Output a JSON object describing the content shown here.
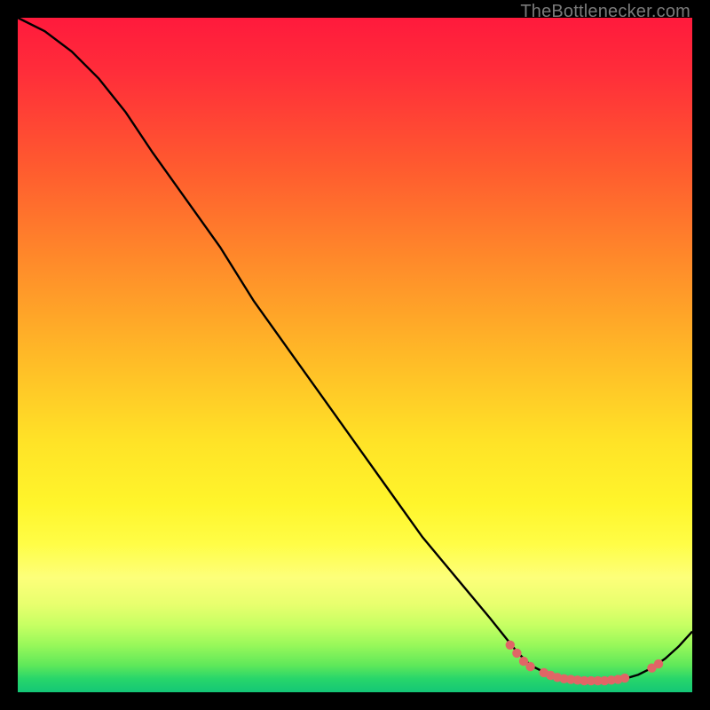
{
  "watermark": "TheBottlenecker.com",
  "chart_data": {
    "type": "line",
    "title": "",
    "xlabel": "",
    "ylabel": "",
    "xlim": [
      0,
      100
    ],
    "ylim": [
      0,
      100
    ],
    "series": [
      {
        "name": "curve",
        "x": [
          0,
          4,
          8,
          12,
          16,
          20,
          25,
          30,
          35,
          40,
          45,
          50,
          55,
          60,
          65,
          70,
          74,
          76,
          78,
          80,
          82,
          84,
          86,
          88,
          90,
          92,
          94,
          96,
          98,
          100
        ],
        "y": [
          100,
          98,
          95,
          91,
          86,
          80,
          73,
          66,
          58,
          51,
          44,
          37,
          30,
          23,
          17,
          11,
          6,
          4,
          3,
          2.2,
          1.8,
          1.6,
          1.6,
          1.7,
          2.0,
          2.6,
          3.6,
          5.0,
          6.8,
          9.0
        ]
      }
    ],
    "markers": [
      {
        "x": 73,
        "y": 7.0
      },
      {
        "x": 74,
        "y": 5.8
      },
      {
        "x": 75,
        "y": 4.6
      },
      {
        "x": 76,
        "y": 3.8
      },
      {
        "x": 78,
        "y": 2.9
      },
      {
        "x": 79,
        "y": 2.5
      },
      {
        "x": 80,
        "y": 2.2
      },
      {
        "x": 81,
        "y": 2.0
      },
      {
        "x": 82,
        "y": 1.9
      },
      {
        "x": 83,
        "y": 1.8
      },
      {
        "x": 84,
        "y": 1.7
      },
      {
        "x": 85,
        "y": 1.7
      },
      {
        "x": 86,
        "y": 1.7
      },
      {
        "x": 87,
        "y": 1.7
      },
      {
        "x": 88,
        "y": 1.8
      },
      {
        "x": 89,
        "y": 1.9
      },
      {
        "x": 90,
        "y": 2.1
      },
      {
        "x": 94,
        "y": 3.6
      },
      {
        "x": 95,
        "y": 4.2
      }
    ],
    "marker_color": "#e06666",
    "line_color": "#000000"
  }
}
